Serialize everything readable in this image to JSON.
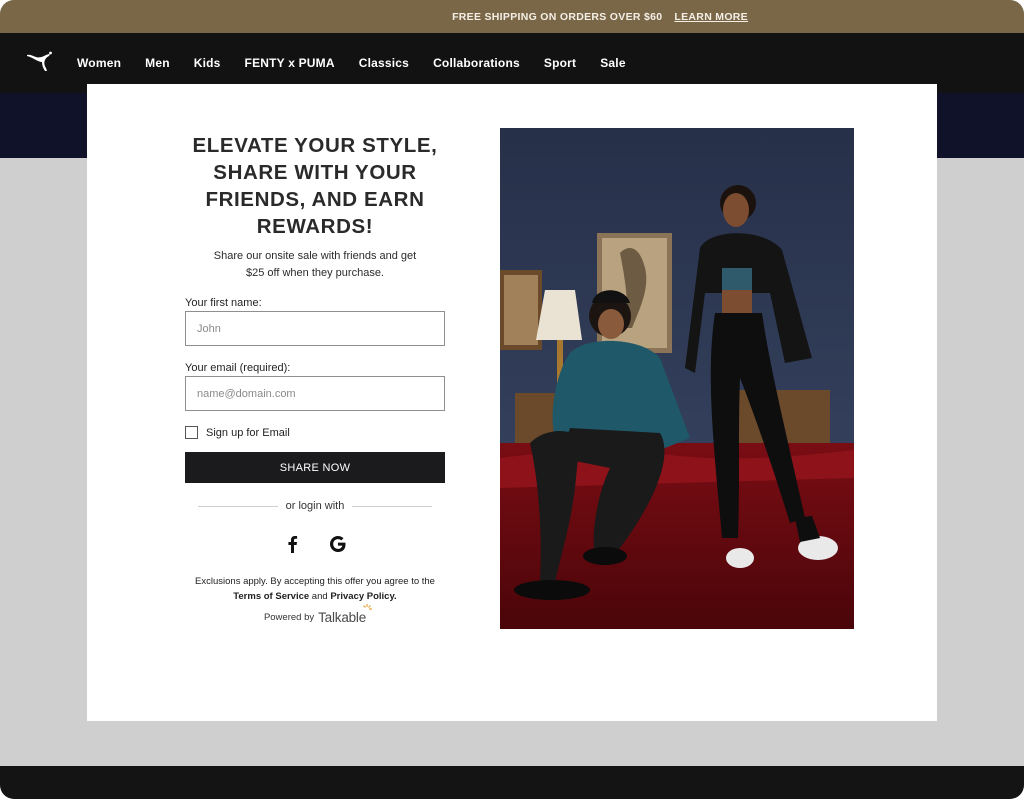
{
  "promo": {
    "text": "FREE SHIPPING ON ORDERS OVER $60",
    "link": "LEARN MORE"
  },
  "nav": {
    "logo_icon": "puma-logo-icon",
    "items": [
      "Women",
      "Men",
      "Kids",
      "FENTY x PUMA",
      "Classics",
      "Collaborations",
      "Sport",
      "Sale"
    ]
  },
  "modal": {
    "headline": "ELEVATE YOUR STYLE,\nSHARE WITH YOUR\nFRIENDS, AND EARN\nREWARDS!",
    "subtext": "Share our onsite sale with friends and get\n$25 off when they purchase.",
    "first_name_label": "Your first name:",
    "first_name_placeholder": "John",
    "email_label": "Your email (required):",
    "email_placeholder": "name@domain.com",
    "checkbox_label": "Sign up for Email",
    "share_button": "SHARE NOW",
    "login_divider": "or login with",
    "social": [
      "facebook-icon",
      "google-icon"
    ],
    "disclaimer_prefix": "Exclusions apply. By accepting this offer you agree to the ",
    "terms_link": "Terms of Service",
    "disclaimer_and": " and ",
    "privacy_link": "Privacy Policy.",
    "powered_by": "Powered by",
    "powered_brand": "Talkable"
  },
  "colors": {
    "promo_bg": "#7a6748",
    "nav_bg": "#121212",
    "hero_band": "#0f1228",
    "button_bg": "#1b1b1d"
  }
}
